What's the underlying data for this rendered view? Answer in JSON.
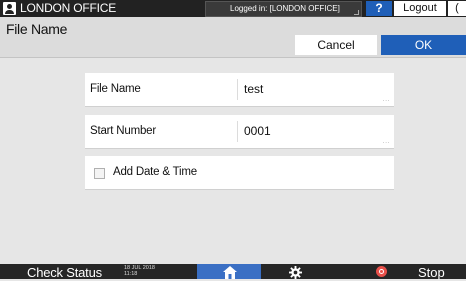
{
  "topbar": {
    "office_title": "LONDON OFFICE",
    "login_status": "Logged in: [LONDON OFFICE]",
    "help_label": "?",
    "logout_label": "Logout",
    "power_glyph": "("
  },
  "header": {
    "title": "File Name",
    "cancel_label": "Cancel",
    "ok_label": "OK"
  },
  "form": {
    "file_name": {
      "label": "File Name",
      "value": "test",
      "more": "..."
    },
    "start_number": {
      "label": "Start Number",
      "value": "0001",
      "more": "..."
    },
    "add_date_time": {
      "label": "Add Date & Time",
      "checked": false
    }
  },
  "bottombar": {
    "check_status_label": "Check Status",
    "date": "18 JUL 2018",
    "time": "11:18",
    "stop_label": "Stop"
  },
  "colors": {
    "accent": "#1f5fb8",
    "dark_bar": "#222222",
    "stop_red": "#e8504a"
  },
  "icons": [
    "user-icon",
    "home-icon",
    "gear-icon",
    "stop-icon",
    "power-icon"
  ]
}
